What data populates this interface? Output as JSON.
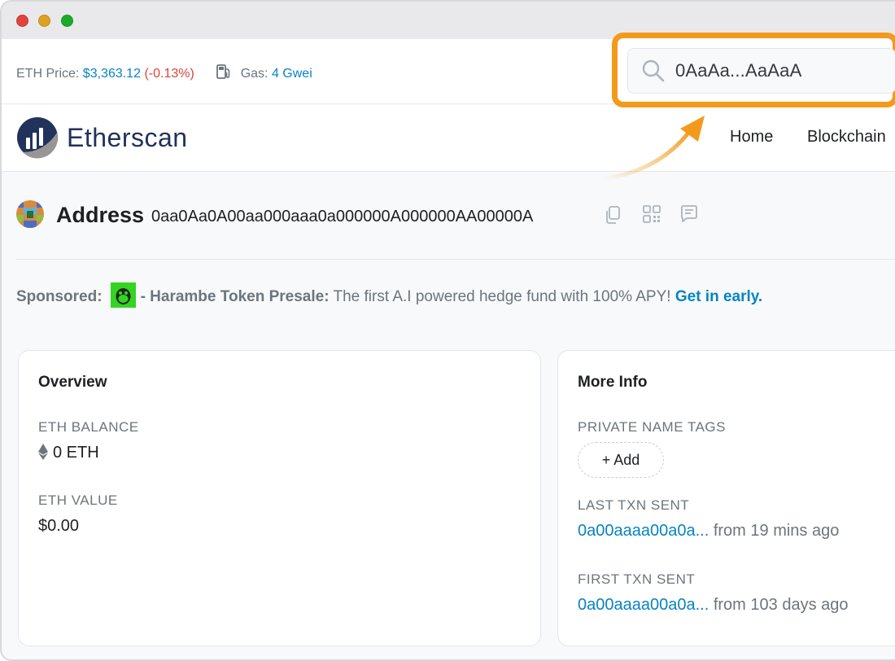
{
  "topbar": {
    "eth_price_label": "ETH Price:",
    "eth_price_value": "$3,363.12",
    "eth_price_change": "(-0.13%)",
    "gas_label": "Gas:",
    "gas_value": "4 Gwei"
  },
  "search": {
    "value": "0AaAa...AaAaA"
  },
  "navbar": {
    "logo_text": "Etherscan",
    "items": [
      "Home",
      "Blockchain"
    ]
  },
  "address": {
    "title": "Address",
    "hash": "0aa0Aa0A00aa000aaa0a000000A000000AA00000A"
  },
  "sponsor": {
    "label": "Sponsored:",
    "name": "- Harambe Token Presale:",
    "text": "The first A.I powered hedge fund with 100% APY!",
    "link": "Get in early."
  },
  "overview": {
    "title": "Overview",
    "balance_label": "ETH BALANCE",
    "balance_value": "0 ETH",
    "value_label": "ETH VALUE",
    "value_value": "$0.00"
  },
  "more_info": {
    "title": "More Info",
    "tags_label": "PRIVATE NAME TAGS",
    "add_label": "+ Add",
    "last_label": "LAST TXN SENT",
    "last_hash": "0a00aaaa00a0a...",
    "last_ago": "from 19 mins ago",
    "first_label": "FIRST TXN SENT",
    "first_hash": "0a00aaaa00a0a...",
    "first_ago": "from 103 days ago"
  },
  "colors": {
    "link": "#0784c3",
    "negative": "#de4437",
    "highlight": "#f39a1d",
    "brand": "#21325b"
  }
}
